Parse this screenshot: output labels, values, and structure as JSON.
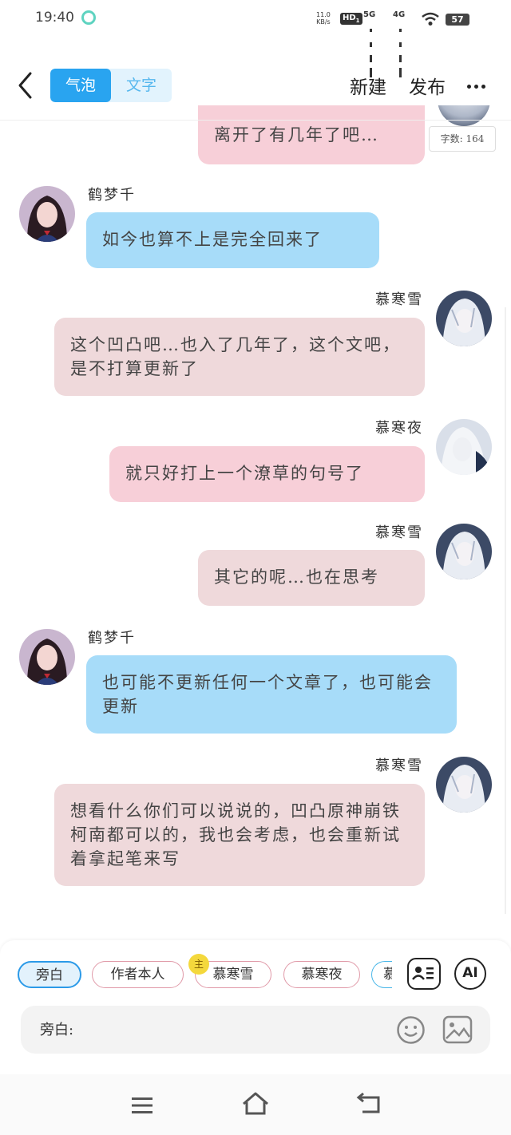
{
  "status_bar": {
    "time": "19:40",
    "net_speed_value": "11.0",
    "net_speed_unit": "KB/s",
    "hd_label": "HD",
    "hd_sub": "1",
    "signal_1_label": "5G",
    "signal_2_label": "4G",
    "battery": "57"
  },
  "header": {
    "tabs": [
      "气泡",
      "文字"
    ],
    "active_tab_index": 0,
    "new_label": "新建",
    "publish_label": "发布"
  },
  "word_count": "字数: 164",
  "messages": [
    {
      "text": "离开了有几年了吧…",
      "side": "right",
      "bubble_color": "#f7cfd8"
    },
    {
      "sender": "鹤梦千",
      "text": "如今也算不上是完全回来了",
      "side": "left",
      "bubble_color": "#a7dcf9"
    },
    {
      "sender": "慕寒雪",
      "text": "这个凹凸吧…也入了几年了，这个文吧，是不打算更新了",
      "side": "right",
      "bubble_color": "#efd9db"
    },
    {
      "sender": "慕寒夜",
      "text": "就只好打上一个潦草的句号了",
      "side": "right",
      "bubble_color": "#f7cfd8"
    },
    {
      "sender": "慕寒雪",
      "text": "其它的呢…也在思考",
      "side": "right",
      "bubble_color": "#efd9db"
    },
    {
      "sender": "鹤梦千",
      "text": "也可能不更新任何一个文章了，也可能会更新",
      "side": "left",
      "bubble_color": "#a7dcf9"
    },
    {
      "sender": "慕寒雪",
      "text": "想看什么你们可以说说的，凹凸原神崩铁柯南都可以的，我也会考虑，也会重新试着拿起笔来写",
      "side": "right",
      "bubble_color": "#efd9db"
    }
  ],
  "roles": [
    "旁白",
    "作者本人",
    "慕寒雪",
    "慕寒夜",
    "慕"
  ],
  "active_role_index": 0,
  "host_badge": "主",
  "input": {
    "label": "旁白:"
  },
  "ai_label": "AI",
  "colors": {
    "accent": "#29a4f0",
    "blue_bubble": "#a7dcf9",
    "pink_bubble": "#f7cfd8",
    "rose_bubble": "#efd9db"
  }
}
